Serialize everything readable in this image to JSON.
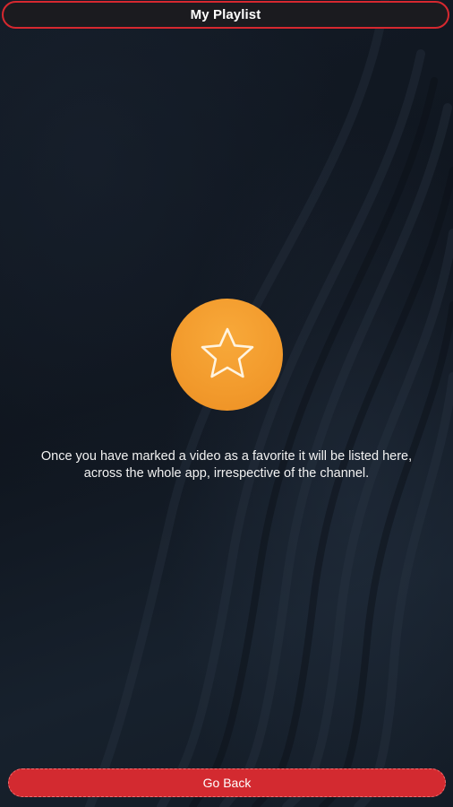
{
  "header": {
    "title": "My Playlist"
  },
  "empty_state": {
    "icon": "star-icon",
    "badge_color": "#f29a2c",
    "message_line1": "Once you have marked a video as a favorite it will be listed here,",
    "message_line2": "across the whole app, irrespective of the channel."
  },
  "footer": {
    "go_back_label": "Go Back"
  },
  "colors": {
    "accent": "#d6282f",
    "background": "#121a24"
  }
}
